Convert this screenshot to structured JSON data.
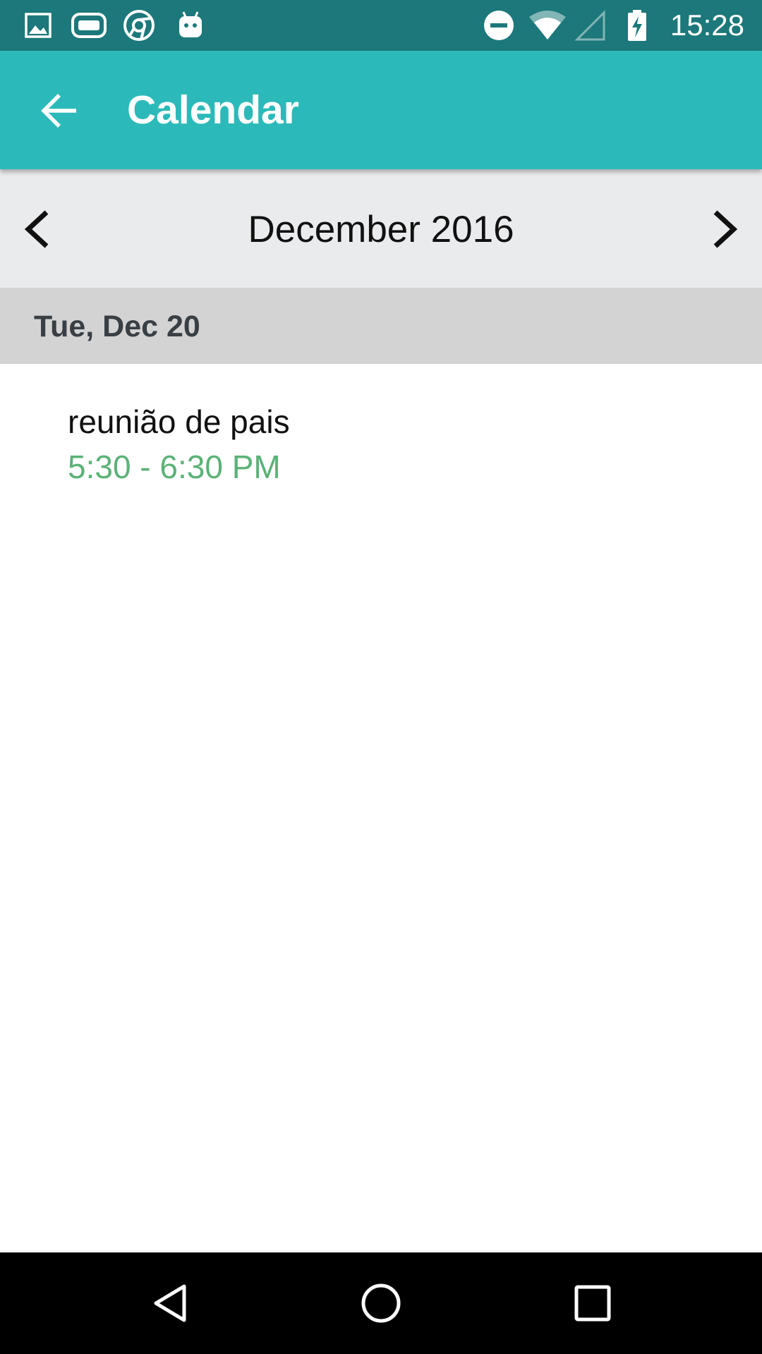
{
  "status_bar": {
    "time": "15:28",
    "icons": [
      "gallery-icon",
      "gamepad-icon",
      "chrome-icon",
      "android-icon",
      "do-not-disturb-icon",
      "wifi-icon",
      "signal-icon",
      "battery-charging-icon"
    ]
  },
  "app_bar": {
    "back_icon": "arrow-left-icon",
    "title": "Calendar"
  },
  "month_nav": {
    "prev_icon": "chevron-left-icon",
    "month": "December 2016",
    "next_icon": "chevron-right-icon"
  },
  "day": {
    "label": "Tue, Dec 20"
  },
  "events": [
    {
      "title": "reunião de pais",
      "time": "5:30 - 6:30 PM"
    }
  ],
  "nav_bar": {
    "buttons": [
      "back-triangle-icon",
      "home-circle-icon",
      "recents-square-icon"
    ]
  },
  "colors": {
    "status_bar": "#1c787a",
    "app_bar": "#2bbab9",
    "month_nav_bg": "#eaebed",
    "day_header_bg": "#d3d3d3",
    "event_time": "#5bb277"
  }
}
